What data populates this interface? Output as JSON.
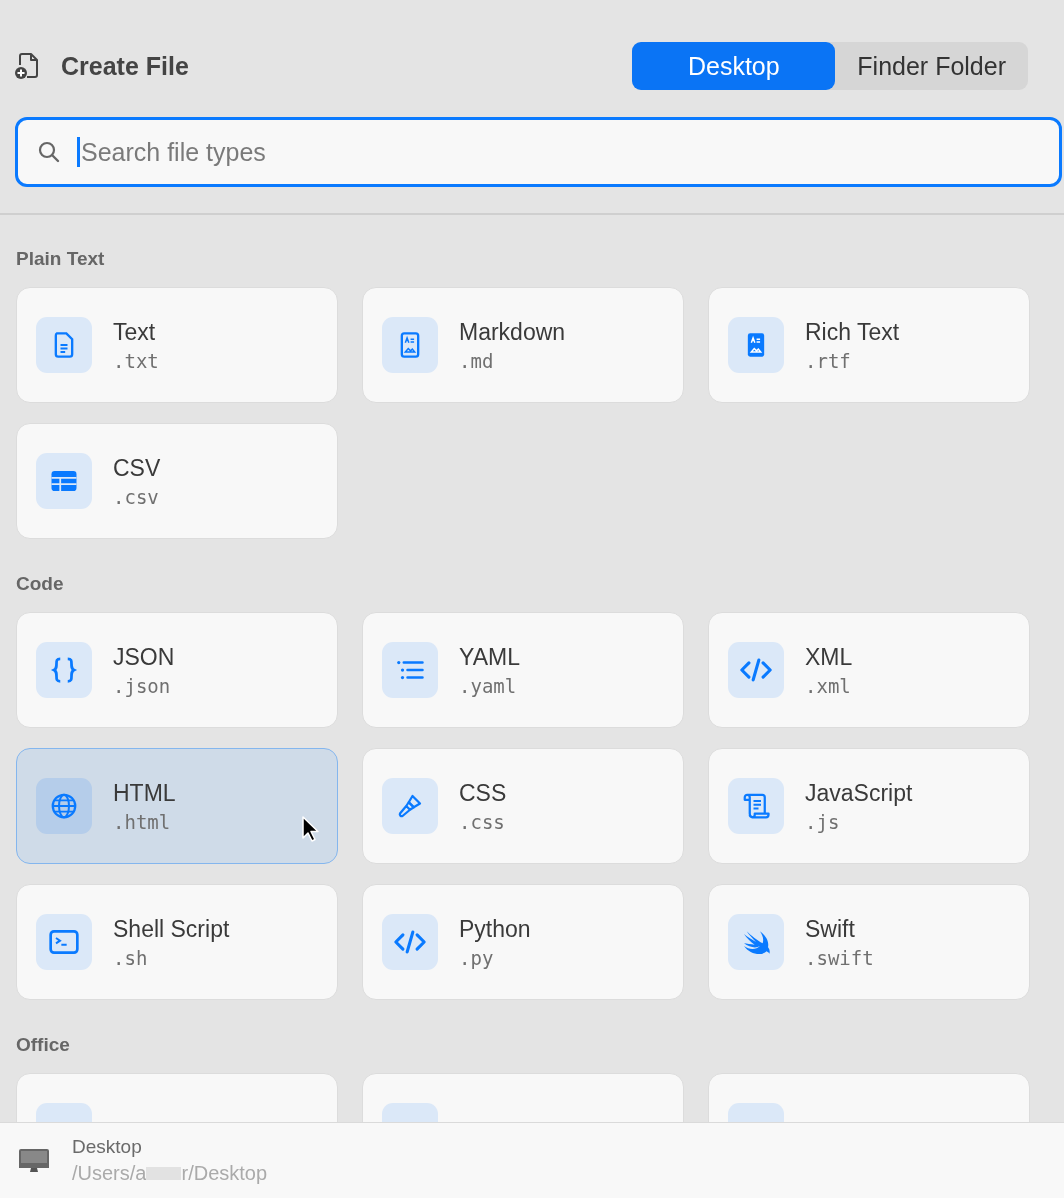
{
  "header": {
    "title": "Create File"
  },
  "location_tabs": [
    {
      "label": "Desktop",
      "selected": true
    },
    {
      "label": "Finder Folder",
      "selected": false
    }
  ],
  "search": {
    "placeholder": "Search file types"
  },
  "sections": [
    {
      "title": "Plain Text",
      "items": [
        {
          "name": "Text",
          "ext": ".txt",
          "kind": "text",
          "selected": false
        },
        {
          "name": "Markdown",
          "ext": ".md",
          "kind": "markdown",
          "selected": false
        },
        {
          "name": "Rich Text",
          "ext": ".rtf",
          "kind": "rich-text",
          "selected": false
        },
        {
          "name": "CSV",
          "ext": ".csv",
          "kind": "table",
          "selected": false
        }
      ]
    },
    {
      "title": "Code",
      "items": [
        {
          "name": "JSON",
          "ext": ".json",
          "kind": "braces",
          "selected": false
        },
        {
          "name": "YAML",
          "ext": ".yaml",
          "kind": "list",
          "selected": false
        },
        {
          "name": "XML",
          "ext": ".xml",
          "kind": "code",
          "selected": false
        },
        {
          "name": "HTML",
          "ext": ".html",
          "kind": "globe",
          "selected": true
        },
        {
          "name": "CSS",
          "ext": ".css",
          "kind": "brush",
          "selected": false
        },
        {
          "name": "JavaScript",
          "ext": ".js",
          "kind": "scroll",
          "selected": false
        },
        {
          "name": "Shell Script",
          "ext": ".sh",
          "kind": "terminal",
          "selected": false
        },
        {
          "name": "Python",
          "ext": ".py",
          "kind": "code",
          "selected": false
        },
        {
          "name": "Swift",
          "ext": ".swift",
          "kind": "swift",
          "selected": false
        }
      ]
    },
    {
      "title": "Office",
      "items": [
        {
          "kind": "blank",
          "selected": false
        },
        {
          "kind": "blank",
          "selected": false
        },
        {
          "kind": "blank",
          "selected": false
        }
      ]
    }
  ],
  "footer": {
    "title": "Desktop",
    "path_start": "/Users/a",
    "path_end": "r/Desktop"
  }
}
